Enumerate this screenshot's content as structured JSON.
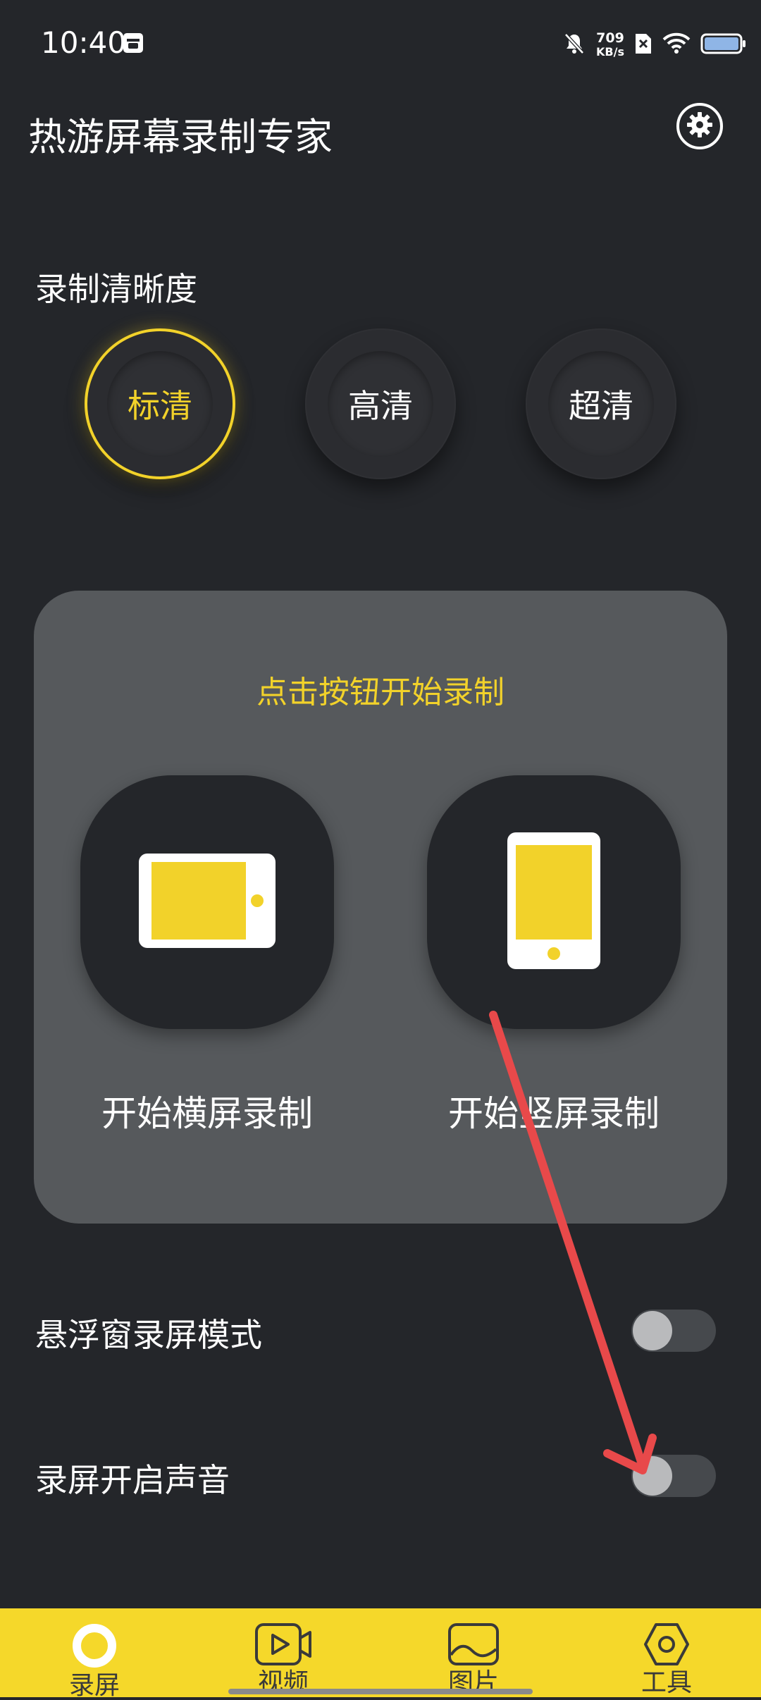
{
  "status_bar": {
    "time": "10:40",
    "net_speed_value": "709",
    "net_speed_unit": "KB/s"
  },
  "header": {
    "title": "热游屏幕录制专家",
    "settings_icon": "gear-icon"
  },
  "quality": {
    "label": "录制清晰度",
    "options": [
      "标清",
      "高清",
      "超清"
    ],
    "selected": "标清"
  },
  "record_card": {
    "hint": "点击按钮开始录制",
    "landscape_label": "开始横屏录制",
    "portrait_label": "开始竖屏录制"
  },
  "settings_rows": {
    "float_window": {
      "label": "悬浮窗录屏模式",
      "on": false
    },
    "record_sound": {
      "label": "录屏开启声音",
      "on": false
    }
  },
  "bottom_nav": {
    "items": [
      {
        "label": "录屏",
        "icon": "record-ring-icon",
        "active": true
      },
      {
        "label": "视频",
        "icon": "video-icon",
        "active": false
      },
      {
        "label": "图片",
        "icon": "image-icon",
        "active": false
      },
      {
        "label": "工具",
        "icon": "tool-nut-icon",
        "active": false
      }
    ]
  },
  "colors": {
    "background": "#24262a",
    "accent": "#f2d22a",
    "card": "#56595c",
    "nav": "#f5d82a",
    "annotation_arrow": "#e8494a"
  }
}
